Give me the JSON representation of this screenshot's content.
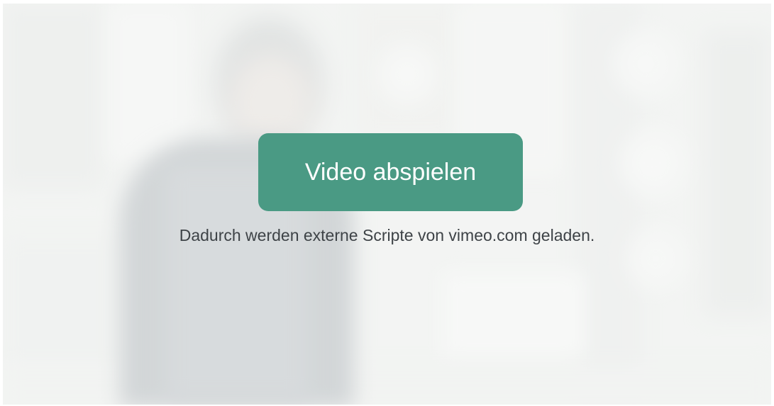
{
  "video_placeholder": {
    "play_label": "Video abspielen",
    "notice": "Dadurch werden externe Scripte von vimeo.com geladen.",
    "accent_color": "#4a9a84",
    "background_image": "blurred-person-photo"
  }
}
